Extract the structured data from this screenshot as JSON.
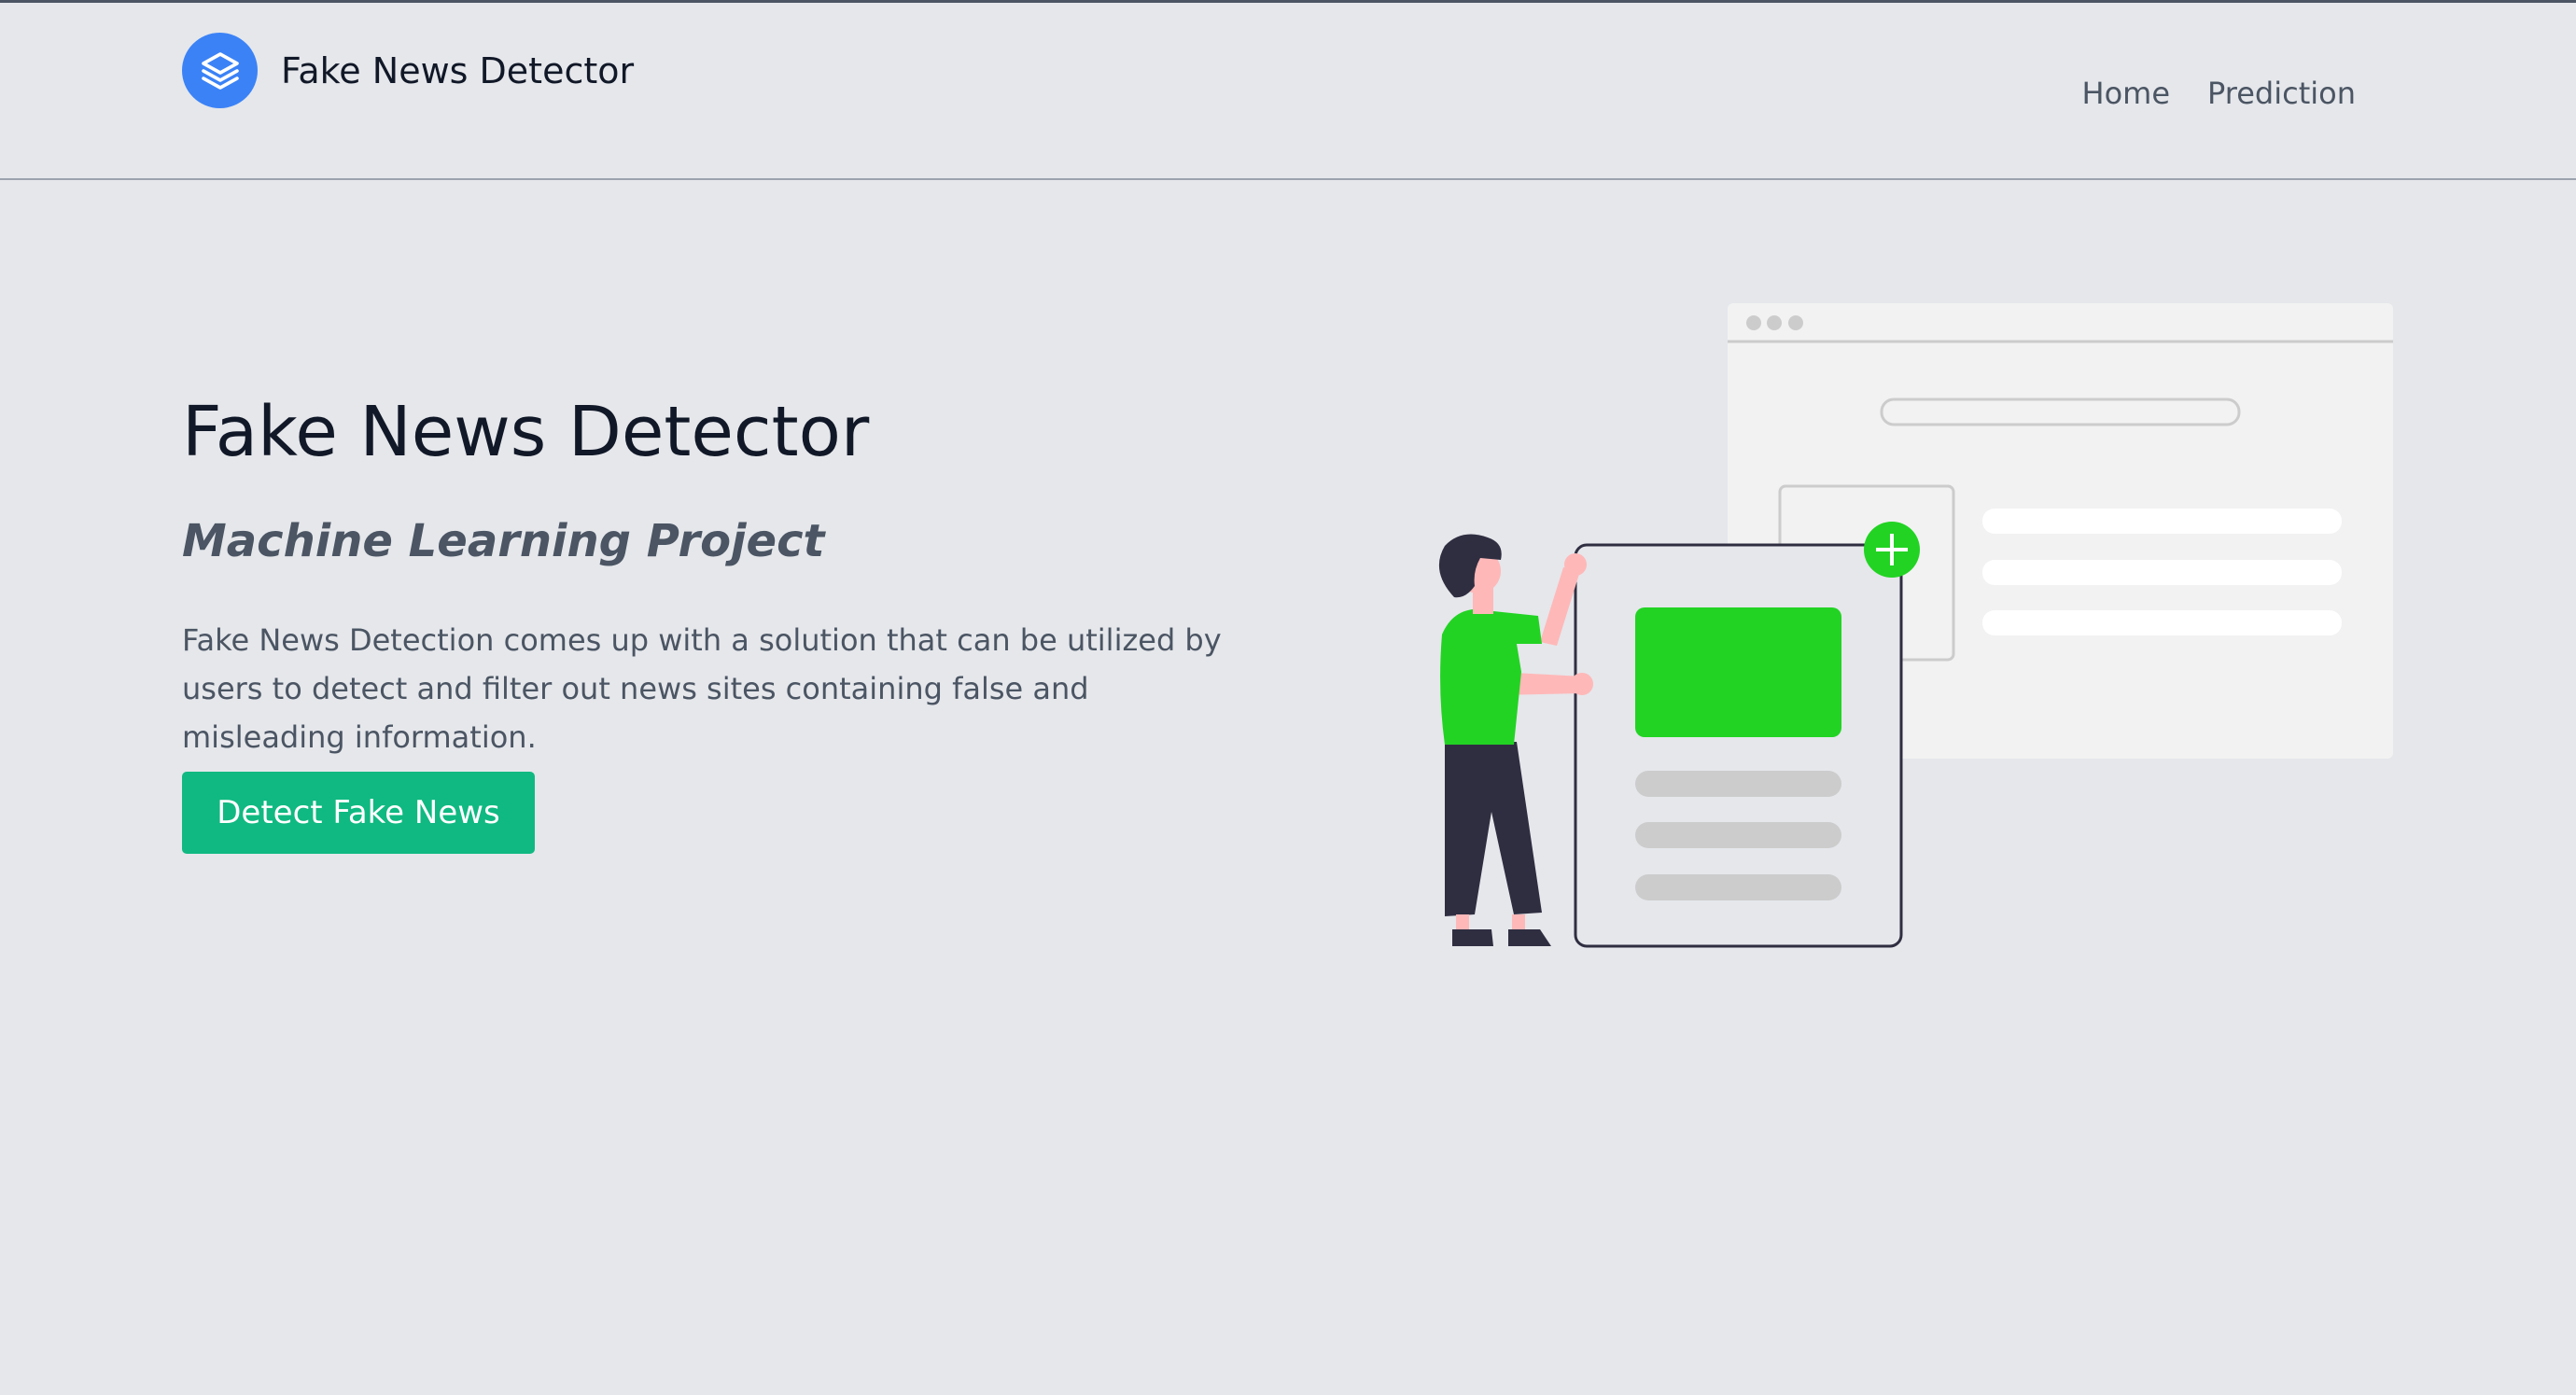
{
  "header": {
    "brand_name": "Fake News Detector",
    "logo_icon": "layers-icon",
    "nav": [
      {
        "label": "Home"
      },
      {
        "label": "Prediction"
      }
    ]
  },
  "hero": {
    "title": "Fake News Detector",
    "subtitle": "Machine Learning Project",
    "description": "Fake News Detection comes up with a solution that can be utilized by users to detect and filter out news sites containing false and misleading information.",
    "cta_label": "Detect Fake News"
  },
  "colors": {
    "background": "#e5e7eb",
    "brand_blue": "#3b82f6",
    "cta_green": "#10b981",
    "illustration_green": "#22d323",
    "title_text": "#111827",
    "body_text": "#4b5563"
  }
}
